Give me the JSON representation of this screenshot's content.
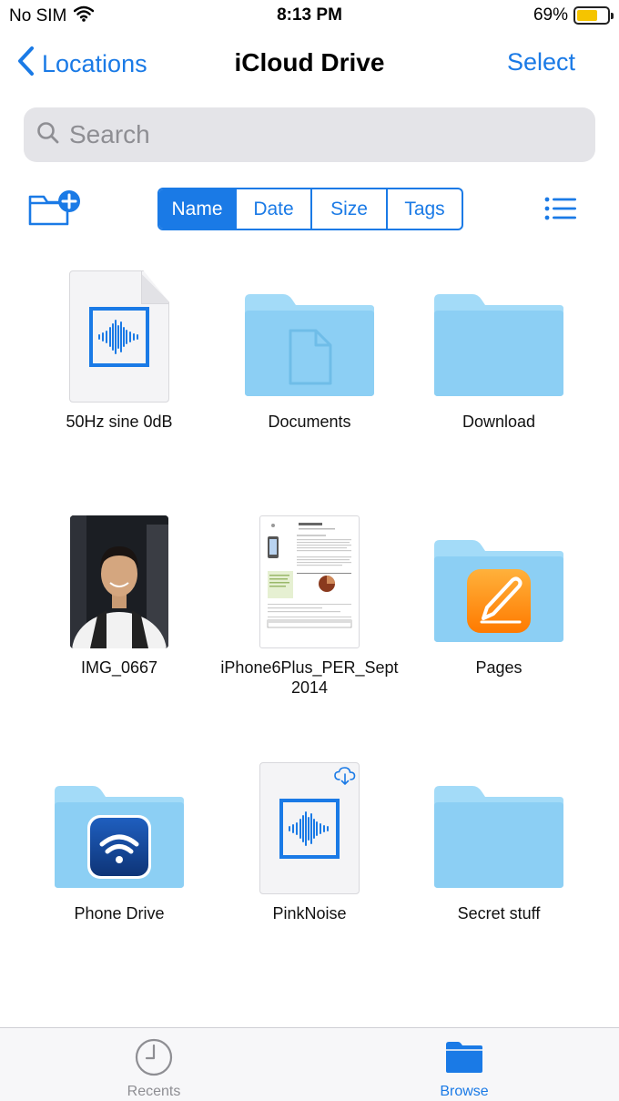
{
  "status": {
    "carrier": "No SIM",
    "time": "8:13 PM",
    "battery_percent": "69%",
    "battery_level": 0.69,
    "battery_color": "#f5c400"
  },
  "nav": {
    "back_label": "Locations",
    "title": "iCloud Drive",
    "select_label": "Select"
  },
  "search": {
    "placeholder": "Search"
  },
  "toolbar": {
    "new_folder_icon": "folder-plus-icon",
    "sort_options": [
      "Name",
      "Date",
      "Size",
      "Tags"
    ],
    "active_sort": "Name",
    "list_view_icon": "list-icon"
  },
  "items": [
    {
      "name": "50Hz sine 0dB",
      "kind": "audio"
    },
    {
      "name": "Documents",
      "kind": "folder-documents"
    },
    {
      "name": "Download",
      "kind": "folder"
    },
    {
      "name": "IMG_0667",
      "kind": "photo"
    },
    {
      "name": "iPhone6Plus_PER_Sept2014",
      "kind": "pdf"
    },
    {
      "name": "Pages",
      "kind": "folder-pages"
    },
    {
      "name": "Phone Drive",
      "kind": "folder-phonedrive"
    },
    {
      "name": "PinkNoise",
      "kind": "audio-cloud"
    },
    {
      "name": "Secret stuff",
      "kind": "folder"
    }
  ],
  "tabbar": {
    "recents_label": "Recents",
    "browse_label": "Browse",
    "active_tab": "Browse"
  },
  "colors": {
    "accent": "#1a7ae6",
    "folder": "#8ccff4",
    "folder_tab": "#a3dbf8",
    "inactive_tab": "#8e8e93"
  }
}
